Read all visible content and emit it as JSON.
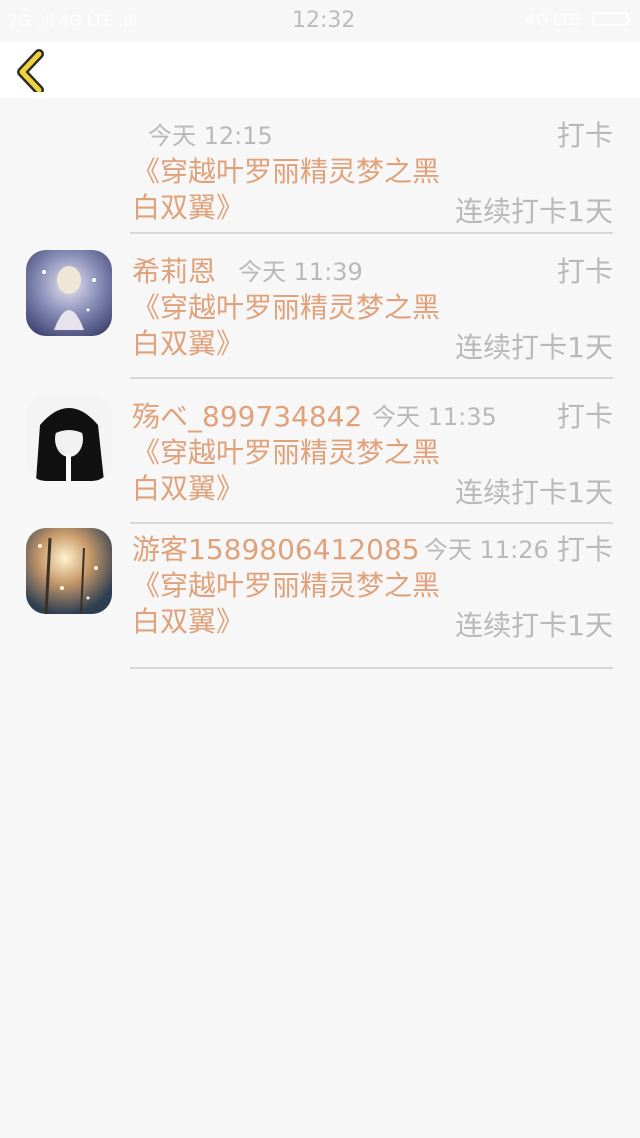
{
  "status_bar": {
    "left_text": "2G .ıll 4G LTE .ıll",
    "time": "12:32",
    "right_text": "4G LTE"
  },
  "colors": {
    "accent": "#e0a27a",
    "muted": "#b9b9b9",
    "back_icon": "#f2d23a"
  },
  "header": {
    "back_icon": "chevron-left-icon"
  },
  "entries": [
    {
      "user": "",
      "time": "今天 12:15",
      "label": "打卡",
      "book": "《穿越叶罗丽精灵梦之黑白双翼》",
      "streak": "连续打卡1天",
      "has_avatar": false
    },
    {
      "user": "希莉恩",
      "time": "今天 11:39",
      "label": "打卡",
      "book": "《穿越叶罗丽精灵梦之黑白双翼》",
      "streak": "连续打卡1天",
      "has_avatar": true
    },
    {
      "user": "殇ベ_899734842",
      "time": "今天 11:35",
      "label": "打卡",
      "book": "《穿越叶罗丽精灵梦之黑白双翼》",
      "streak": "连续打卡1天",
      "has_avatar": true
    },
    {
      "user": "游客1589806412085",
      "time": "今天 11:26",
      "label": "打卡",
      "book": "《穿越叶罗丽精灵梦之黑白双翼》",
      "streak": "连续打卡1天",
      "has_avatar": true
    }
  ]
}
